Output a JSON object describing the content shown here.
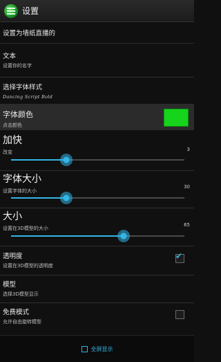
{
  "app": {
    "title": "设置"
  },
  "section": {
    "label": "设置为墙纸直播的"
  },
  "prefs": {
    "text": {
      "title": "文本",
      "summary": "设置你的名字"
    },
    "font_style": {
      "title": "选择字体样式",
      "preview": "Dancing Script Bold"
    },
    "font_color": {
      "title": "字体颜色",
      "summary": "点击颜色",
      "swatch_color": "#16d41c"
    },
    "speed": {
      "title": "加快",
      "summary": "改变",
      "value": "3",
      "fraction": 0.32
    },
    "font_size": {
      "title": "字体大小",
      "summary": "设置字体的大小",
      "value": "30",
      "fraction": 0.32
    },
    "size": {
      "title": "大小",
      "summary": "设置在3D模型的大小",
      "value": "65",
      "fraction": 0.65
    },
    "transparency": {
      "title": "透明度",
      "summary": "设置在3D模型的透明度",
      "checked": true
    },
    "model": {
      "title": "模型",
      "summary": "选择3D模型显示"
    },
    "free_mode": {
      "title": "免费模式",
      "summary": "允许自由旋转模型",
      "checked": false
    }
  },
  "footer": {
    "fullscreen_label": "全屏显示"
  },
  "colors": {
    "accent": "#33b5e5",
    "background": "#101010"
  }
}
